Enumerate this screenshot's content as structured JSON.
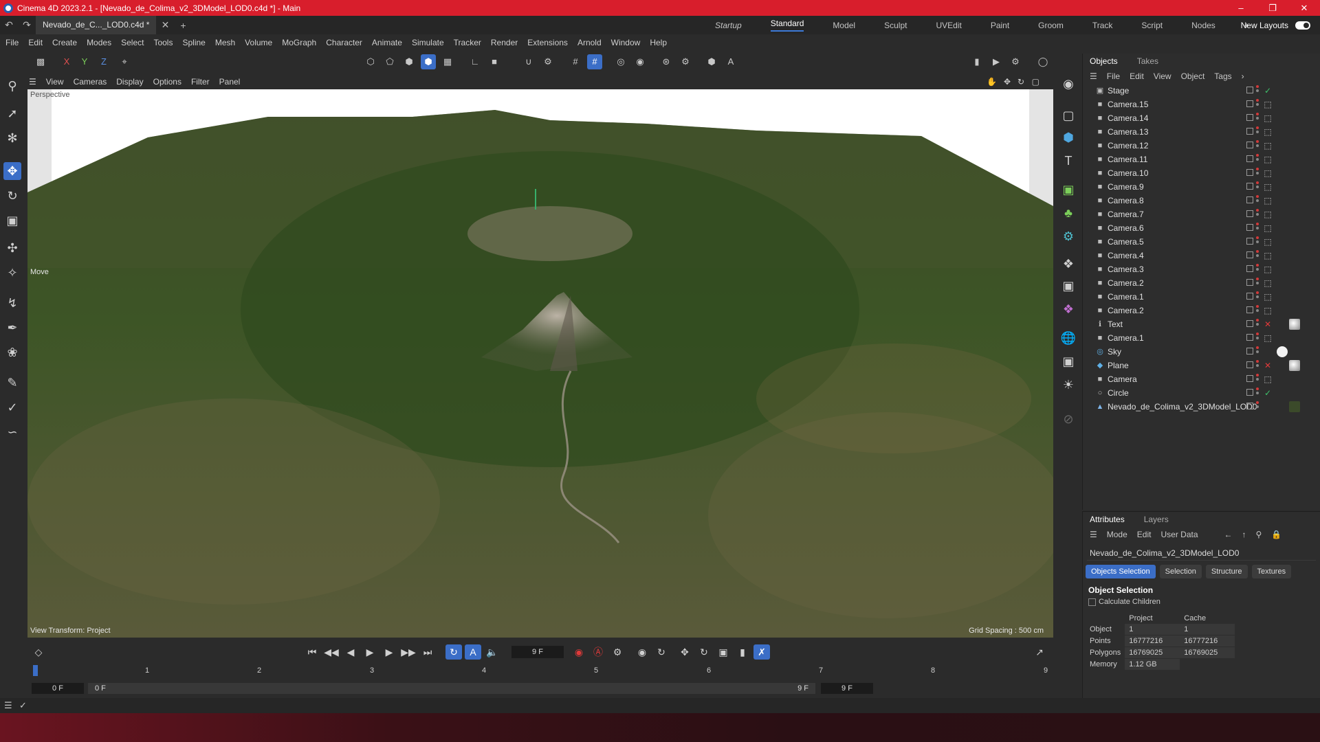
{
  "window": {
    "title": "Cinema 4D 2023.2.1 - [Nevado_de_Colima_v2_3DModel_LOD0.c4d *] - Main"
  },
  "tabbar": {
    "doc_tab": "Nevado_de_C..._LOD0.c4d *",
    "layouts": [
      "Startup",
      "Standard",
      "Model",
      "Sculpt",
      "UVEdit",
      "Paint",
      "Groom",
      "Track",
      "Script",
      "Nodes"
    ],
    "active_layout": "Standard",
    "new_layouts": "New Layouts"
  },
  "menu": [
    "File",
    "Edit",
    "Create",
    "Modes",
    "Select",
    "Tools",
    "Spline",
    "Mesh",
    "Volume",
    "MoGraph",
    "Character",
    "Animate",
    "Simulate",
    "Tracker",
    "Render",
    "Extensions",
    "Arnold",
    "Window",
    "Help"
  ],
  "toolbar": {
    "axis_x": "X",
    "axis_y": "Y",
    "axis_z": "Z"
  },
  "viewport": {
    "menu": [
      "View",
      "Cameras",
      "Display",
      "Options",
      "Filter",
      "Panel"
    ],
    "camera_label": "Perspective",
    "tool_label": "Move",
    "view_transform": "View Transform: Project",
    "grid_spacing": "Grid Spacing : 500 cm"
  },
  "objects_panel": {
    "tabs": [
      "Objects",
      "Takes"
    ],
    "menu": [
      "File",
      "Edit",
      "View",
      "Object",
      "Tags"
    ],
    "items": [
      {
        "name": "Stage",
        "icon": "stage-icon",
        "tag": "check"
      },
      {
        "name": "Camera.15",
        "icon": "camera-icon",
        "tag": "target"
      },
      {
        "name": "Camera.14",
        "icon": "camera-icon",
        "tag": "target"
      },
      {
        "name": "Camera.13",
        "icon": "camera-icon",
        "tag": "target"
      },
      {
        "name": "Camera.12",
        "icon": "camera-icon",
        "tag": "target"
      },
      {
        "name": "Camera.11",
        "icon": "camera-icon",
        "tag": "target"
      },
      {
        "name": "Camera.10",
        "icon": "camera-icon",
        "tag": "target"
      },
      {
        "name": "Camera.9",
        "icon": "camera-icon",
        "tag": "target"
      },
      {
        "name": "Camera.8",
        "icon": "camera-icon",
        "tag": "target"
      },
      {
        "name": "Camera.7",
        "icon": "camera-icon",
        "tag": "target"
      },
      {
        "name": "Camera.6",
        "icon": "camera-icon",
        "tag": "target"
      },
      {
        "name": "Camera.5",
        "icon": "camera-icon",
        "tag": "target"
      },
      {
        "name": "Camera.4",
        "icon": "camera-icon",
        "tag": "target"
      },
      {
        "name": "Camera.3",
        "icon": "camera-icon",
        "tag": "target"
      },
      {
        "name": "Camera.2",
        "icon": "camera-icon",
        "tag": "target"
      },
      {
        "name": "Camera.1",
        "icon": "camera-icon",
        "tag": "target"
      },
      {
        "name": "Camera.2",
        "icon": "camera-icon",
        "tag": "target"
      },
      {
        "name": "Text",
        "icon": "text-icon",
        "tag": "x"
      },
      {
        "name": "Camera.1",
        "icon": "camera-icon",
        "tag": "target"
      },
      {
        "name": "Sky",
        "icon": "sky-icon",
        "tag": ""
      },
      {
        "name": "Plane",
        "icon": "plane-icon",
        "tag": "x"
      },
      {
        "name": "Camera",
        "icon": "camera-icon",
        "tag": "target"
      },
      {
        "name": "Circle",
        "icon": "circle-icon",
        "tag": "check"
      },
      {
        "name": "Nevado_de_Colima_v2_3DModel_LOD0",
        "icon": "polygon-icon",
        "tag": ""
      }
    ]
  },
  "attributes_panel": {
    "tabs": [
      "Attributes",
      "Layers"
    ],
    "menu": [
      "Mode",
      "Edit",
      "User Data"
    ],
    "object_name": "Nevado_de_Colima_v2_3DModel_LOD0",
    "subtabs": [
      "Objects Selection",
      "Selection",
      "Structure",
      "Textures"
    ],
    "section": "Object Selection",
    "calc_children": "Calculate Children",
    "columns": [
      "Project",
      "Cache"
    ],
    "rows": [
      {
        "label": "Object",
        "project": "1",
        "cache": "1"
      },
      {
        "label": "Points",
        "project": "16777216",
        "cache": "16777216"
      },
      {
        "label": "Polygons",
        "project": "16769025",
        "cache": "16769025"
      },
      {
        "label": "Memory",
        "project": "1.12 GB",
        "cache": ""
      }
    ]
  },
  "timeline": {
    "current_frame": "9 F",
    "ticks": [
      "0",
      "1",
      "2",
      "3",
      "4",
      "5",
      "6",
      "7",
      "8",
      "9"
    ],
    "start": "0 F",
    "range_start": "0 F",
    "range_end": "9 F",
    "end": "9 F"
  },
  "colors": {
    "accent": "#3b6ec7",
    "titlebar": "#d81e2c",
    "panel": "#2b2b2b"
  }
}
